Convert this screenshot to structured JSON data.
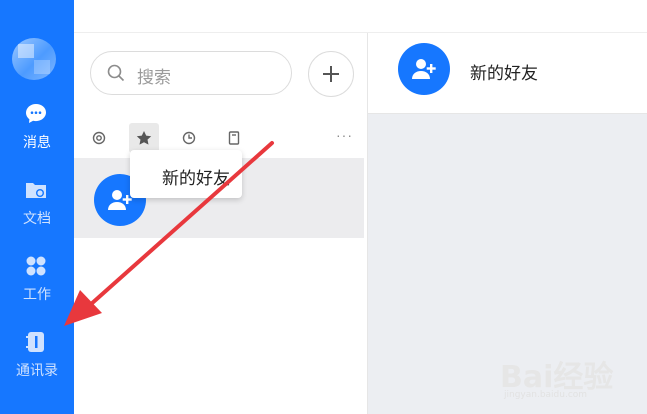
{
  "sidebar": {
    "items": [
      {
        "label": "消息",
        "icon": "message-icon",
        "active": true
      },
      {
        "label": "文档",
        "icon": "document-folder-icon",
        "active": false
      },
      {
        "label": "工作",
        "icon": "workbench-icon",
        "active": false
      },
      {
        "label": "通讯录",
        "icon": "contacts-book-icon",
        "active": false
      }
    ]
  },
  "search": {
    "placeholder": "搜索"
  },
  "filters": [
    "mention-icon",
    "star-icon",
    "clock-icon",
    "bookmark-icon"
  ],
  "more_label": "···",
  "session": {
    "title": "新的好友",
    "icon": "add-friend-icon"
  },
  "chat": {
    "title": "新的好友"
  },
  "watermark": {
    "text": "Bai经验",
    "url": "jingyan.baidu.com"
  },
  "colors": {
    "brand": "#1677ff",
    "arrow": "#e8383d"
  }
}
